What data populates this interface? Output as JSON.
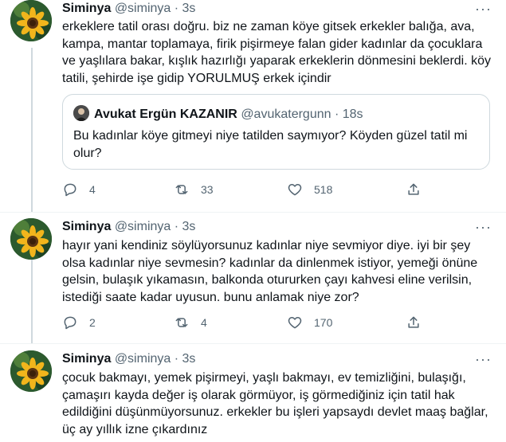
{
  "tweets": [
    {
      "name": "Siminya",
      "handle": "@siminya",
      "time": "3s",
      "text": "erkeklere tatil orası doğru. biz ne zaman köye gitsek erkekler balığa, ava, kampa, mantar toplamaya, firik pişirmeye falan gider kadınlar da çocuklara ve yaşlılara bakar, kışlık hazırlığı yaparak erkeklerin dönmesini beklerdi. köy tatili, şehirde işe gidip YORULMUŞ erkek içindir",
      "quote": {
        "name": "Avukat Ergün KAZANIR",
        "handle": "@avukatergunn",
        "time": "18s",
        "text": "Bu kadınlar köye gitmeyi niye tatilden saymıyor? Köyden güzel tatil mi olur?"
      },
      "replies": "4",
      "retweets": "33",
      "likes": "518"
    },
    {
      "name": "Siminya",
      "handle": "@siminya",
      "time": "3s",
      "text": "hayır yani kendiniz söylüyorsunuz kadınlar niye sevmiyor diye. iyi bir şey olsa kadınlar niye sevmesin? kadınlar da dinlenmek istiyor, yemeği önüne gelsin, bulaşık yıkamasın, balkonda otururken çayı kahvesi eline verilsin, istediği saate kadar uyusun. bunu anlamak niye zor?",
      "replies": "2",
      "retweets": "4",
      "likes": "170"
    },
    {
      "name": "Siminya",
      "handle": "@siminya",
      "time": "3s",
      "text": "çocuk bakmayı, yemek pişirmeyi, yaşlı bakmayı, ev temizliğini, bulaşığı, çamaşırı kayda değer iş olarak görmüyor, iş görmediğiniz için tatil hak edildiğini düşünmüyorsunuz. erkekler bu işleri yapsaydı devlet maaş bağlar, üç ay yıllık izne çıkardınız"
    }
  ],
  "separator": "·",
  "more_glyph": "···",
  "colors": {
    "text": "#0f1419",
    "muted": "#536471",
    "border": "#cfd9de"
  }
}
